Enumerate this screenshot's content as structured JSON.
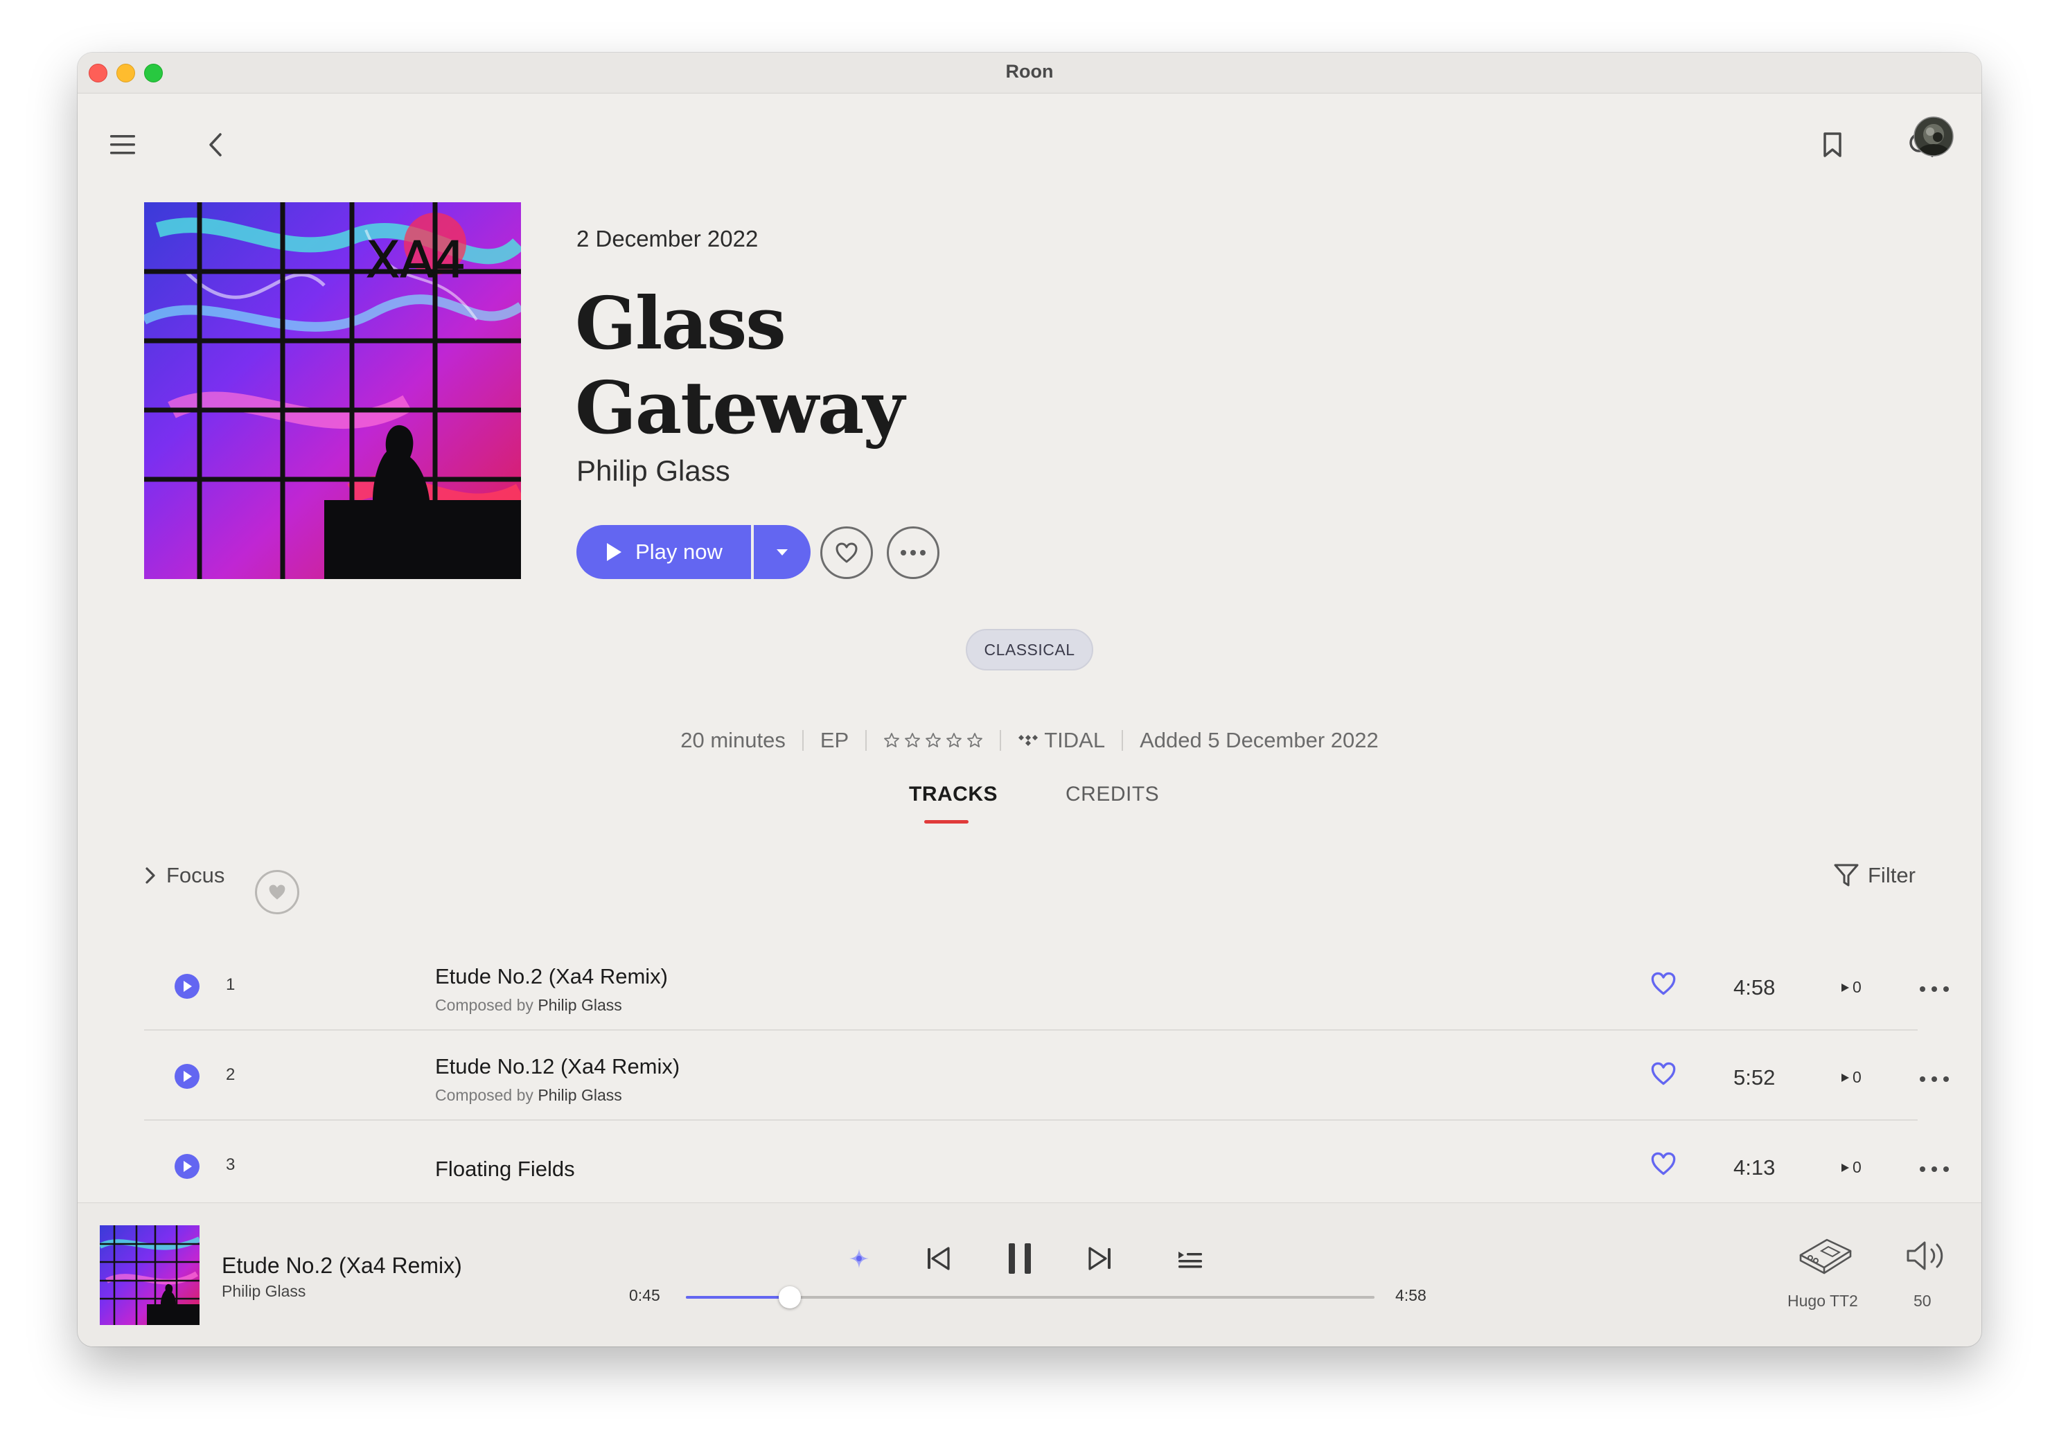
{
  "window": {
    "title": "Roon"
  },
  "album": {
    "release_date": "2 December 2022",
    "title_line1": "Glass",
    "title_line2": "Gateway",
    "artist": "Philip Glass",
    "cover_text": "XA4",
    "genre": "CLASSICAL"
  },
  "actions": {
    "play_label": "Play now"
  },
  "meta": {
    "duration": "20 minutes",
    "format": "EP",
    "rating_stars": 0,
    "source": "TIDAL",
    "added": "Added 5 December 2022"
  },
  "tabs": [
    {
      "label": "TRACKS",
      "active": true
    },
    {
      "label": "CREDITS",
      "active": false
    }
  ],
  "toolbar": {
    "focus_label": "Focus",
    "filter_label": "Filter"
  },
  "tracks": [
    {
      "number": "1",
      "title": "Etude No.2 (Xa4 Remix)",
      "composed_prefix": "Composed by",
      "composer": "Philip Glass",
      "duration": "4:58",
      "plays": "0"
    },
    {
      "number": "2",
      "title": "Etude No.12 (Xa4 Remix)",
      "composed_prefix": "Composed by",
      "composer": "Philip Glass",
      "duration": "5:52",
      "plays": "0"
    },
    {
      "number": "3",
      "title": "Floating Fields",
      "composed_prefix": "",
      "composer": "",
      "duration": "4:13",
      "plays": "0"
    }
  ],
  "now_playing": {
    "title": "Etude No.2 (Xa4 Remix)",
    "artist": "Philip Glass",
    "elapsed": "0:45",
    "total": "4:58",
    "progress_fraction": 0.151,
    "zone": "Hugo TT2",
    "volume": "50"
  },
  "colors": {
    "accent": "#6366f1",
    "tab_underline": "#e03a3a",
    "window_bg": "#f0eeeb"
  },
  "icons": [
    "hamburger-menu-icon",
    "back-chevron-icon",
    "bookmark-icon",
    "search-icon",
    "avatar",
    "play-icon",
    "caret-down-icon",
    "heart-icon",
    "more-horizontal-icon",
    "chevron-right-icon",
    "filter-funnel-icon",
    "radio-sparkle-icon",
    "skip-previous-icon",
    "pause-icon",
    "skip-next-icon",
    "queue-icon",
    "zone-device-icon",
    "volume-icon"
  ]
}
